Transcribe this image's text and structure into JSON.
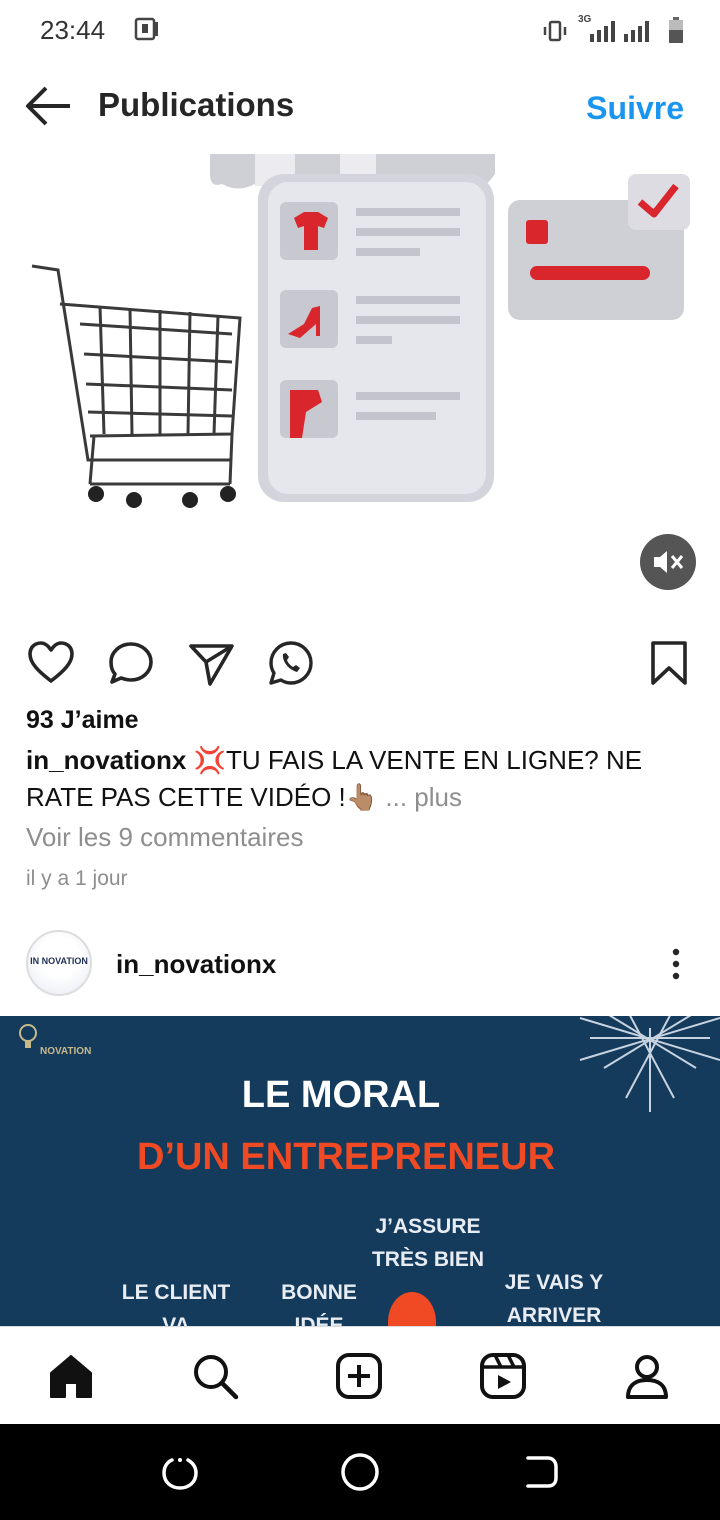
{
  "status_bar": {
    "time": "23:44",
    "network_label": "3G",
    "icons": [
      "screenshot-icon",
      "vibrate-icon",
      "signal-icon",
      "battery-icon"
    ]
  },
  "header": {
    "title": "Publications",
    "follow_label": "Suivre",
    "accent_color": "#1a95f0"
  },
  "post": {
    "likes": "93 J’aime",
    "author": "in_novationx",
    "caption": " 💢TU FAIS LA VENTE EN LIGNE? NE RATE PAS CETTE VIDÉO !👆🏽",
    "more": "... plus",
    "comments_link": "Voir les 9 commentaires",
    "timestamp": "il y a 1 jour"
  },
  "next_post": {
    "avatar_text": "IN NOVATION",
    "username": "in_novationx",
    "image": {
      "brand": "NOVATION",
      "headline_line1": "LE MORAL",
      "headline_line2": "D’UN ENTREPRENEUR",
      "moods": {
        "client_1": "LE CLIENT",
        "client_2": "VA ADORER",
        "idea_1": "BONNE",
        "idea_2": "IDÉE",
        "assure_1": "J’ASSURE",
        "assure_2": "TRÈS BIEN",
        "arrive_1": "JE VAIS Y",
        "arrive_2": "ARRIVER"
      }
    }
  },
  "bottom_nav": [
    "home-icon",
    "search-icon",
    "create-icon",
    "reels-icon",
    "profile-icon"
  ],
  "system_nav": [
    "recents-icon",
    "home-circle-icon",
    "back-nav-icon"
  ]
}
